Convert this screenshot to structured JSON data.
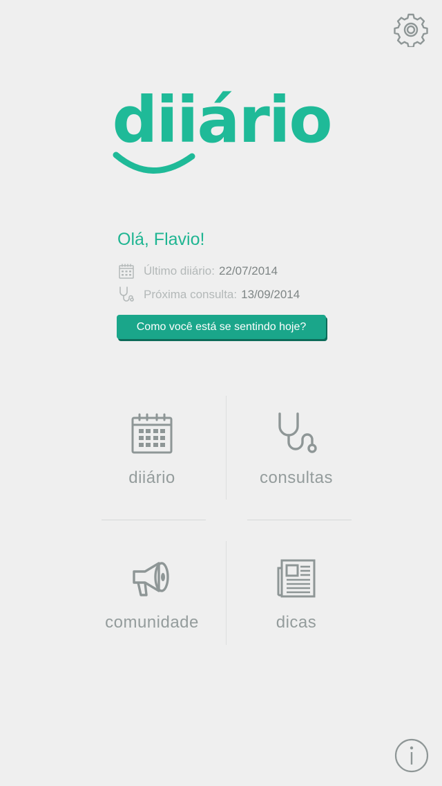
{
  "app": {
    "logo_text": "diiário",
    "brand_color": "#1fba98",
    "button_color": "#1aa68a",
    "icon_color": "#8e9696"
  },
  "header": {
    "settings_icon": "gear-icon"
  },
  "greeting": {
    "text": "Olá, Flavio!",
    "last_diary_label": "Último diiário:",
    "last_diary_value": "22/07/2014",
    "last_diary_icon": "calendar-icon",
    "next_appointment_label": "Próxima consulta:",
    "next_appointment_value": "13/09/2014",
    "next_appointment_icon": "stethoscope-icon",
    "cta_label": "Como você está se sentindo hoje?"
  },
  "menu": {
    "items": [
      {
        "label": "diiário",
        "icon": "calendar-icon"
      },
      {
        "label": "consultas",
        "icon": "stethoscope-icon"
      },
      {
        "label": "comunidade",
        "icon": "megaphone-icon"
      },
      {
        "label": "dicas",
        "icon": "newspaper-icon"
      }
    ]
  },
  "footer": {
    "info_icon": "info-icon"
  }
}
